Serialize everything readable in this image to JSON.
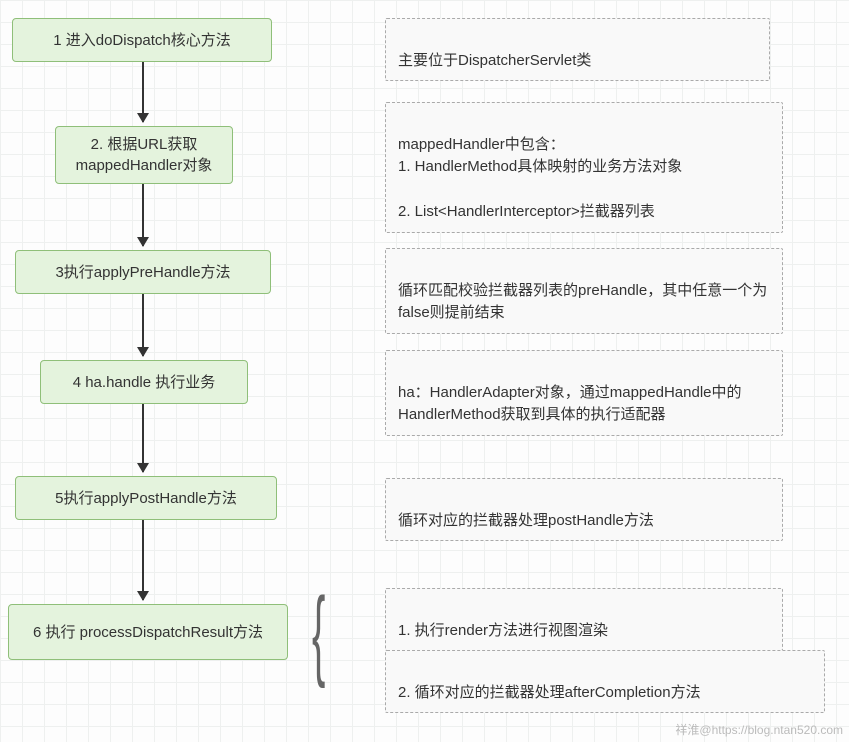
{
  "steps": {
    "s1": "1 进入doDispatch核心方法",
    "s2": "2. 根据URL获取\nmappedHandler对象",
    "s3": "3执行applyPreHandle方法",
    "s4": "4 ha.handle 执行业务",
    "s5": "5执行applyPostHandle方法",
    "s6": "6 执行\nprocessDispatchResult方法"
  },
  "notes": {
    "n1": "主要位于DispatcherServlet类",
    "n2": "mappedHandler中包含：\n1. HandlerMethod具体映射的业务方法对象\n\n2. List<HandlerInterceptor>拦截器列表",
    "n3": "循环匹配校验拦截器列表的preHandle，其中任意一个为false则提前结束",
    "n4": "ha：HandlerAdapter对象，通过mappedHandle中的HandlerMethod获取到具体的执行适配器",
    "n5": "循环对应的拦截器处理postHandle方法",
    "n6a": "1. 执行render方法进行视图渲染",
    "n6b": "2. 循环对应的拦截器处理afterCompletion方法"
  },
  "watermark": "祥淮@https://blog.ntan520.com"
}
